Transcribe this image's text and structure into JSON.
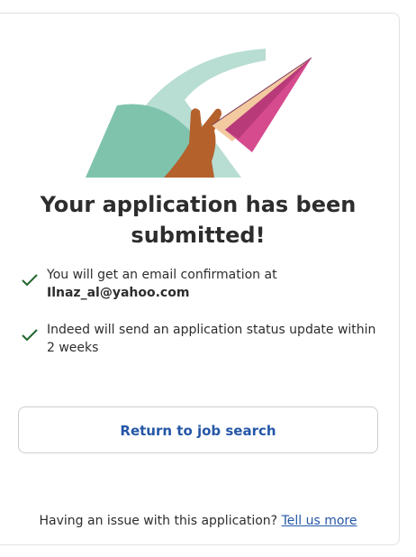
{
  "confirmation": {
    "title": "Your application has been submitted!",
    "items": [
      {
        "text": "You will get an email confirmation at",
        "email": "Ilnaz_al@yahoo.com"
      },
      {
        "text": "Indeed will send an application status update within 2 weeks"
      }
    ],
    "return_button_label": "Return to job search",
    "issue_text": "Having an issue with this application?",
    "issue_link": "Tell us more"
  },
  "colors": {
    "accent": "#2557a7",
    "check": "#1f662c",
    "teal": "#7fc3ad",
    "plane_pink": "#d54b8e",
    "plane_peach": "#f3c9a0",
    "hand": "#b4612c"
  }
}
